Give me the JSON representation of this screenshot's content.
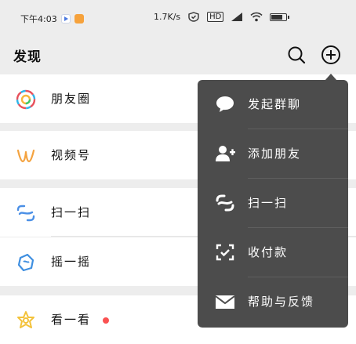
{
  "status_bar": {
    "time": "下午4:03",
    "net_speed": "1.7K/s",
    "hd_badge": "HD",
    "battery_level": 0.85
  },
  "header": {
    "title": "发现"
  },
  "list": {
    "items": [
      {
        "label": "朋友圈",
        "icon": "moments-icon"
      },
      {
        "label": "视频号",
        "icon": "channels-icon"
      },
      {
        "label": "扫一扫",
        "icon": "scan-icon"
      },
      {
        "label": "摇一摇",
        "icon": "shake-icon"
      },
      {
        "label": "看一看",
        "icon": "top-stories-icon",
        "badge": "red-dot"
      }
    ]
  },
  "popup_menu": {
    "items": [
      {
        "label": "发起群聊",
        "icon": "chat-bubble-icon"
      },
      {
        "label": "添加朋友",
        "icon": "add-friend-icon"
      },
      {
        "label": "扫一扫",
        "icon": "scan-icon"
      },
      {
        "label": "收付款",
        "icon": "payment-icon"
      },
      {
        "label": "帮助与反馈",
        "icon": "mail-icon"
      }
    ]
  },
  "colors": {
    "background": "#ededed",
    "menu_background": "#4c4c4c",
    "badge_red": "#fa5151"
  }
}
